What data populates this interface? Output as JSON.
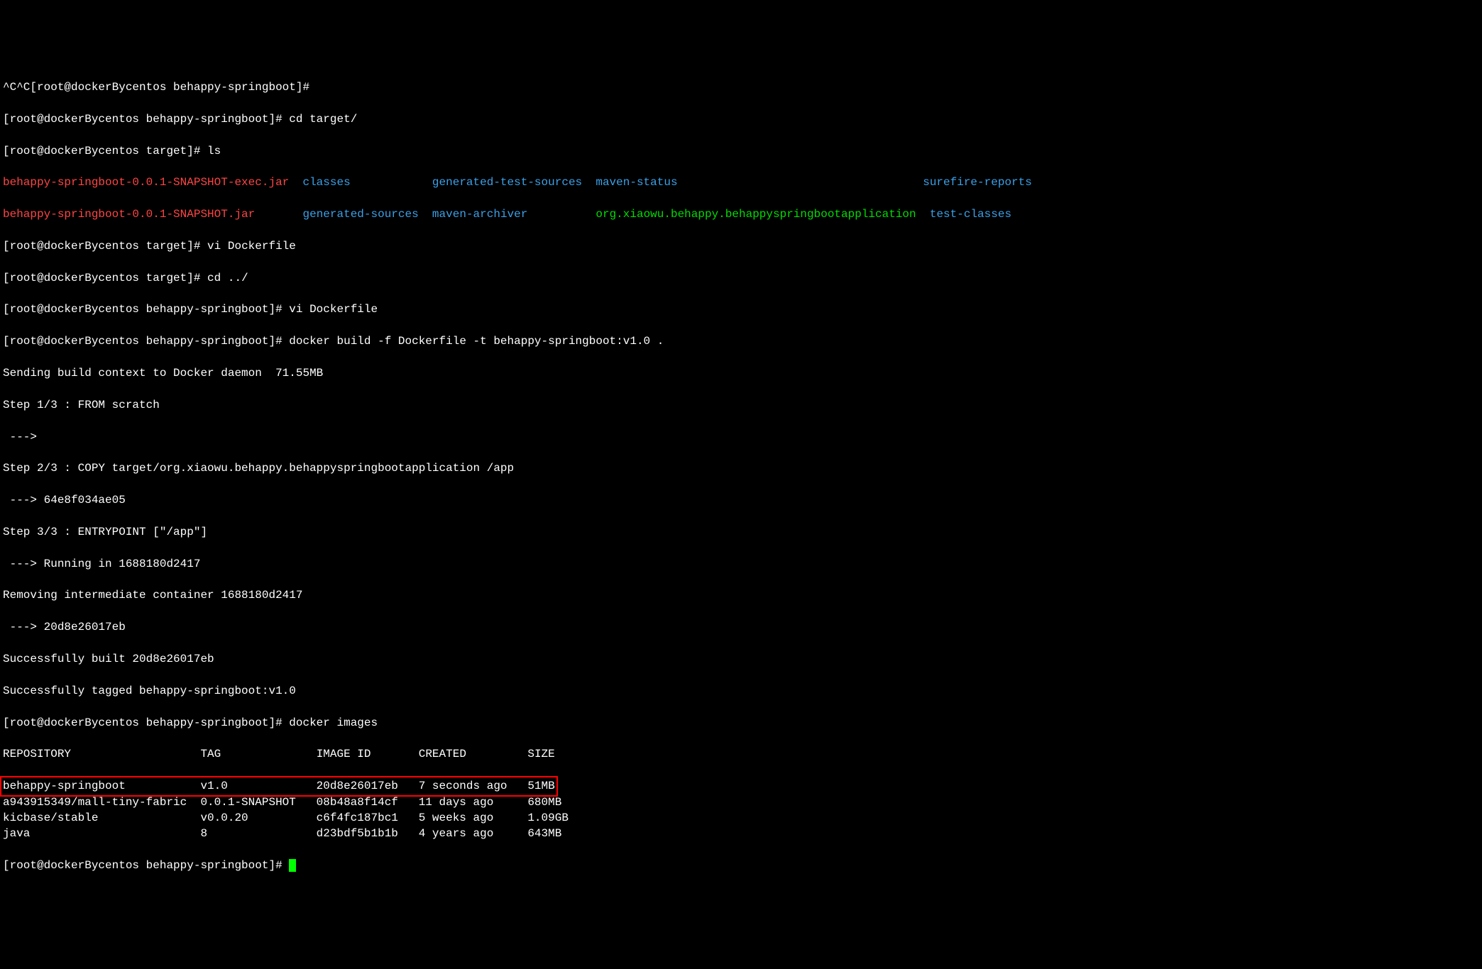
{
  "lines": [
    {
      "type": "plain",
      "text": "^C^C[root@dockerBycentos behappy-springboot]#"
    },
    {
      "type": "prompt",
      "prompt": "[root@dockerBycentos behappy-springboot]#",
      "cmd": " cd target/"
    },
    {
      "type": "prompt",
      "prompt": "[root@dockerBycentos target]#",
      "cmd": " ls"
    }
  ],
  "ls_row1": {
    "c1": {
      "text": "behappy-springboot-0.0.1-SNAPSHOT-exec.jar",
      "color": "red"
    },
    "c2": {
      "text": "classes",
      "color": "blue"
    },
    "c3": {
      "text": "generated-test-sources",
      "color": "blue"
    },
    "c4": {
      "text": "maven-status",
      "color": "blue"
    },
    "c5": {
      "text": "surefire-reports",
      "color": "blue"
    }
  },
  "ls_row2": {
    "c1": {
      "text": "behappy-springboot-0.0.1-SNAPSHOT.jar",
      "color": "red"
    },
    "c2": {
      "text": "generated-sources",
      "color": "blue"
    },
    "c3": {
      "text": "maven-archiver",
      "color": "blue"
    },
    "c4": {
      "text": "org.xiaowu.behappy.behappyspringbootapplication",
      "color": "green"
    },
    "c5": {
      "text": "test-classes",
      "color": "blue"
    }
  },
  "commands": [
    {
      "prompt": "[root@dockerBycentos target]#",
      "cmd": " vi Dockerfile"
    },
    {
      "prompt": "[root@dockerBycentos target]#",
      "cmd": " cd ../"
    },
    {
      "prompt": "[root@dockerBycentos behappy-springboot]#",
      "cmd": " vi Dockerfile"
    },
    {
      "prompt": "[root@dockerBycentos behappy-springboot]#",
      "cmd": " docker build -f Dockerfile -t behappy-springboot:v1.0 ."
    }
  ],
  "build_output": [
    "Sending build context to Docker daemon  71.55MB",
    "Step 1/3 : FROM scratch",
    " ---> ",
    "Step 2/3 : COPY target/org.xiaowu.behappy.behappyspringbootapplication /app",
    " ---> 64e8f034ae05",
    "Step 3/3 : ENTRYPOINT [\"/app\"]",
    " ---> Running in 1688180d2417",
    "Removing intermediate container 1688180d2417",
    " ---> 20d8e26017eb",
    "Successfully built 20d8e26017eb",
    "Successfully tagged behappy-springboot:v1.0"
  ],
  "images_cmd": {
    "prompt": "[root@dockerBycentos behappy-springboot]#",
    "cmd": " docker images"
  },
  "table_header": {
    "repo": "REPOSITORY",
    "tag": "TAG",
    "imgid": "IMAGE ID",
    "created": "CREATED",
    "size": "SIZE"
  },
  "table_rows": [
    {
      "repo": "behappy-springboot",
      "tag": "v1.0",
      "imgid": "20d8e26017eb",
      "created": "7 seconds ago",
      "size": "51MB",
      "highlight": true
    },
    {
      "repo": "a943915349/mall-tiny-fabric",
      "tag": "0.0.1-SNAPSHOT",
      "imgid": "08b48a8f14cf",
      "created": "11 days ago",
      "size": "680MB"
    },
    {
      "repo": "kicbase/stable",
      "tag": "v0.0.20",
      "imgid": "c6f4fc187bc1",
      "created": "5 weeks ago",
      "size": "1.09GB"
    },
    {
      "repo": "java",
      "tag": "8",
      "imgid": "d23bdf5b1b1b",
      "created": "4 years ago",
      "size": "643MB"
    }
  ],
  "final_prompt": "[root@dockerBycentos behappy-springboot]# "
}
